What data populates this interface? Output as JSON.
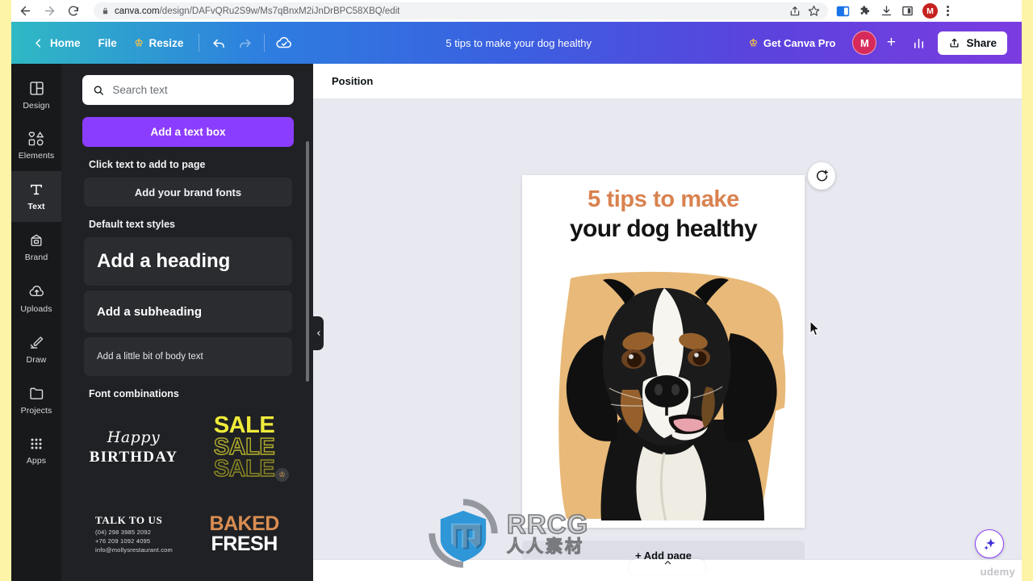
{
  "browser": {
    "back_icon": "back-arrow-icon",
    "forward_icon": "forward-arrow-icon",
    "reload_icon": "reload-icon",
    "lock_icon": "lock-icon",
    "url_host": "canva.com",
    "url_path": "/design/DAFvQRu2S9w/Ms7qBnxM2iJnDrBPC58XBQ/edit",
    "share_icon": "share-icon",
    "bookmark_icon": "star-icon",
    "sidepanel_icon": "side-panel-icon",
    "extensions_icon": "puzzle-piece-icon",
    "downloads_icon": "download-icon",
    "split_icon": "split-screen-icon",
    "profile_initial": "M",
    "menu_icon": "kebab-menu-icon"
  },
  "topbar": {
    "back_chevron": "chevron-left-icon",
    "home": "Home",
    "file": "File",
    "resize": "Resize",
    "resize_crown": "crown-icon",
    "undo": "undo-icon",
    "redo": "redo-icon",
    "cloud_saved": "cloud-check-icon",
    "doc_title": "5 tips to make your dog healthy",
    "get_pro": "Get Canva Pro",
    "pro_crown": "crown-icon",
    "avatar_initial": "M",
    "add_member": "+",
    "insights_icon": "bar-chart-icon",
    "share": "Share",
    "share_icon": "upload-icon",
    "accent_gradient_start": "#2fb9c4",
    "accent_gradient_end": "#7b3ce0"
  },
  "rail": {
    "items": [
      {
        "label": "Design",
        "icon": "layout-icon",
        "active": false
      },
      {
        "label": "Elements",
        "icon": "shapes-icon",
        "active": false
      },
      {
        "label": "Text",
        "icon": "text-t-icon",
        "active": true
      },
      {
        "label": "Brand",
        "icon": "brand-icon",
        "active": false
      },
      {
        "label": "Uploads",
        "icon": "upload-cloud-icon",
        "active": false
      },
      {
        "label": "Draw",
        "icon": "pen-icon",
        "active": false
      },
      {
        "label": "Projects",
        "icon": "folder-icon",
        "active": false
      },
      {
        "label": "Apps",
        "icon": "grid-dots-icon",
        "active": false
      }
    ]
  },
  "panel": {
    "search_placeholder": "Search text",
    "search_value": "",
    "search_icon": "search-icon",
    "add_text_box": "Add a text box",
    "click_hint": "Click text to add to page",
    "brand_fonts": "Add your brand fonts",
    "default_styles_label": "Default text styles",
    "styles": [
      {
        "label": "Add a heading"
      },
      {
        "label": "Add a subheading"
      },
      {
        "label": "Add a little bit of body text"
      }
    ],
    "font_combinations_label": "Font combinations",
    "combos": [
      {
        "name": "happy-birthday",
        "line1": "Happy",
        "line2": "BIRTHDAY",
        "pro": false
      },
      {
        "name": "sale",
        "line1": "SALE",
        "line2": "SALE",
        "line3": "SALE",
        "pro": true,
        "pro_icon": "crown-icon"
      },
      {
        "name": "talk-to-us",
        "heading": "TALK TO US",
        "l1": "(04) 298 3985 2092",
        "l2": "+76 209 1092 4095",
        "l3": "info@mollysrestaurant.com",
        "pro": false
      },
      {
        "name": "baked-fresh",
        "line1": "BAKED",
        "line2": "FRESH",
        "pro": false
      }
    ],
    "collapse_icon": "chevron-left-icon"
  },
  "editor": {
    "position_label": "Position",
    "lock_icon": "lock-icon",
    "duplicate_icon": "duplicate-page-icon",
    "add_page_icon": "add-page-icon",
    "comment_icon": "comment-add-icon",
    "add_page_label": "+ Add page",
    "magic_icon": "sparkle-icon",
    "bottom_tab_icon": "chevron-up-icon"
  },
  "design": {
    "title_line1": "5 tips to make",
    "title_line2": "your dog healthy",
    "title_color": "#d9824f",
    "subtitle_color": "#131313",
    "background_color": "#ffffff",
    "brush_color": "#e8b978",
    "artwork": "dog-portrait-illustration"
  },
  "watermarks": {
    "rrcg_title": "RRCG",
    "rrcg_sub": "人人素材",
    "rrcg_logo": "shield-logo-icon",
    "udemy": "udemy"
  }
}
